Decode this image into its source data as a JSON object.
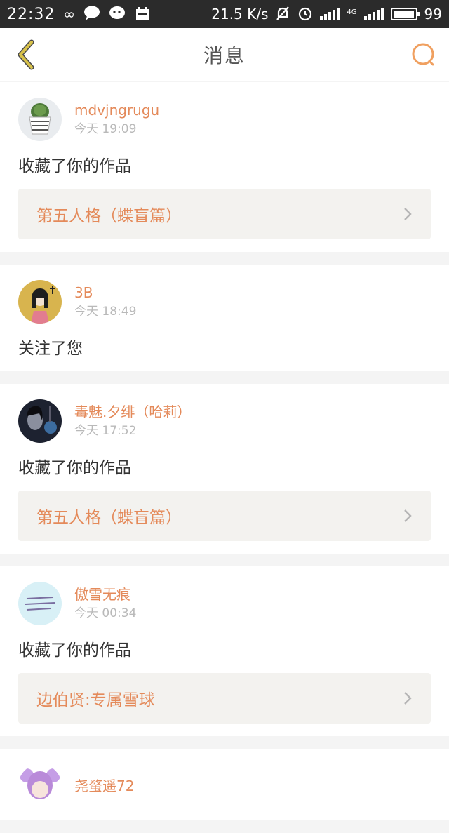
{
  "status_bar": {
    "time": "22:32",
    "speed": "21.5 K/s",
    "network": "4G",
    "battery": "99",
    "battery_level": 0.99
  },
  "header": {
    "title": "消息",
    "back_icon": "chevron-left-icon",
    "search_icon": "search-icon"
  },
  "colors": {
    "accent": "#e48a5a",
    "back_icon": "#c9b23a",
    "work_link_bg": "#f3f2ef"
  },
  "messages": [
    {
      "username": "mdvjngrugu",
      "time": "今天 19:09",
      "action": "收藏了你的作品",
      "work": "第五人格（蝶盲篇）",
      "avatar": "cactus-avatar"
    },
    {
      "username": "3B",
      "time": "今天 18:49",
      "action": "关注了您",
      "work": null,
      "avatar": "girl-drawing-avatar"
    },
    {
      "username": "毒魅.夕绯（哈莉）",
      "time": "今天 17:52",
      "action": "收藏了你的作品",
      "work": "第五人格（蝶盲篇）",
      "avatar": "dark-portrait-avatar"
    },
    {
      "username": "傲雪无痕",
      "time": "今天 00:34",
      "action": "收藏了你的作品",
      "work": "边伯贤:专属雪球",
      "avatar": "text-note-avatar"
    },
    {
      "username": "尧蝥遥72",
      "avatar": "purple-hair-avatar"
    }
  ]
}
